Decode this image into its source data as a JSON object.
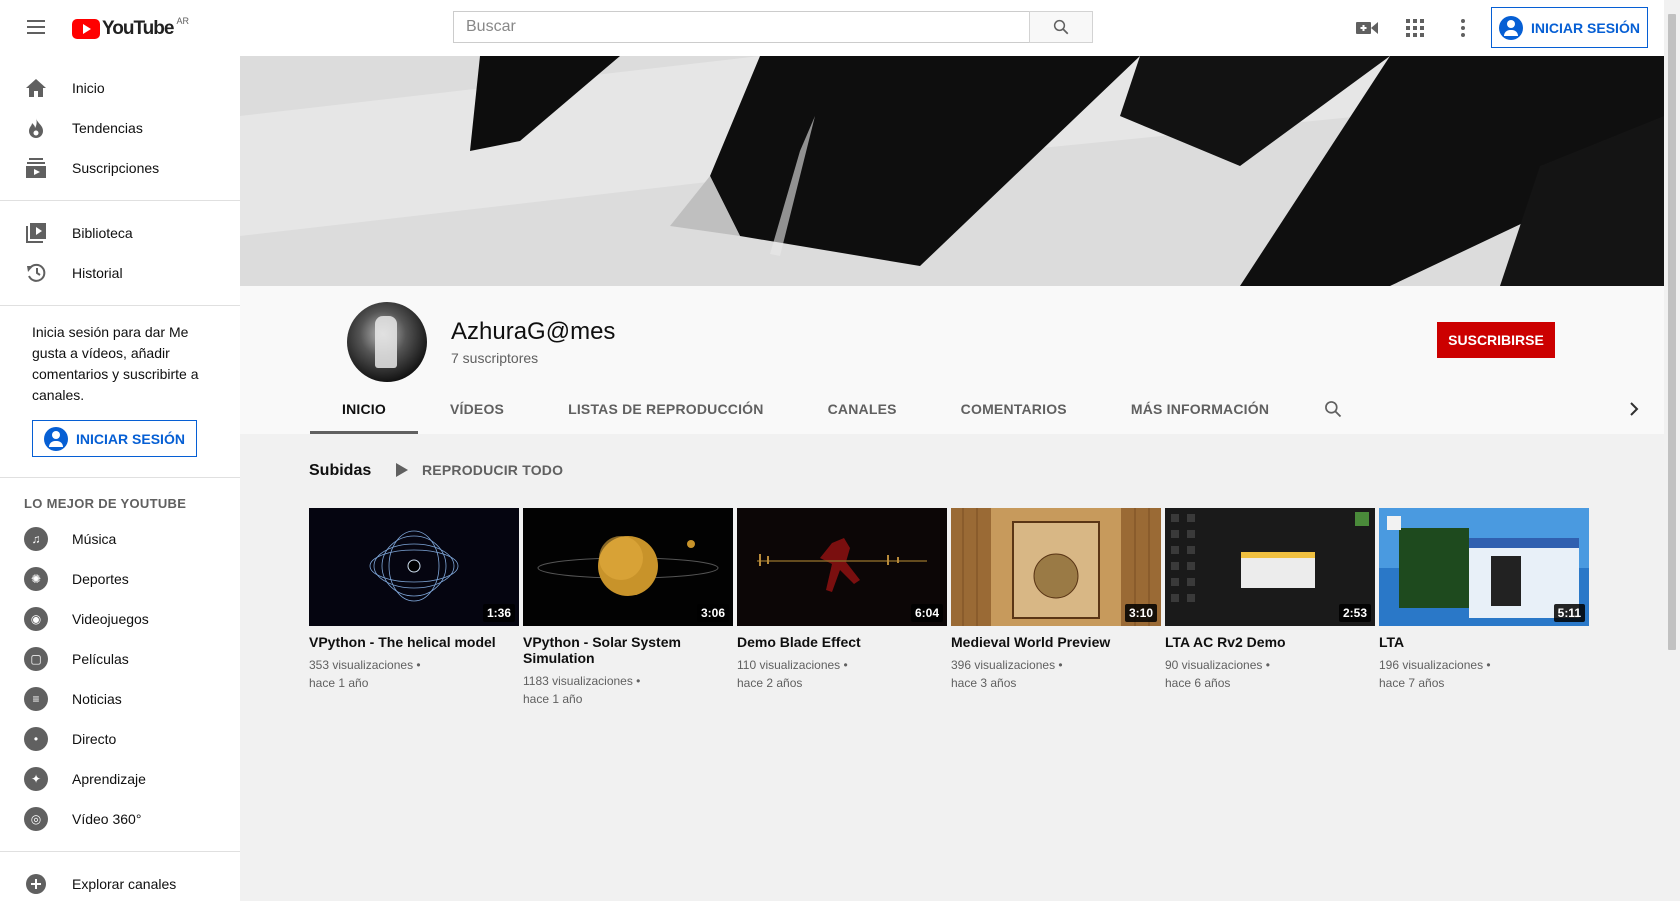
{
  "header": {
    "logo_text": "YouTube",
    "country": "AR",
    "search_placeholder": "Buscar",
    "signin_label": "INICIAR SESIÓN"
  },
  "sidebar": {
    "main": [
      {
        "label": "Inicio",
        "icon": "home-icon"
      },
      {
        "label": "Tendencias",
        "icon": "fire-icon"
      },
      {
        "label": "Suscripciones",
        "icon": "subscriptions-icon"
      }
    ],
    "library": [
      {
        "label": "Biblioteca",
        "icon": "library-icon"
      },
      {
        "label": "Historial",
        "icon": "history-icon"
      }
    ],
    "promo_text": "Inicia sesión para dar Me gusta a vídeos, añadir comentarios y suscribirte a canales.",
    "signin_label": "INICIAR SESIÓN",
    "best_heading": "LO MEJOR DE YOUTUBE",
    "categories": [
      {
        "label": "Música",
        "icon": "music-icon"
      },
      {
        "label": "Deportes",
        "icon": "sports-icon"
      },
      {
        "label": "Videojuegos",
        "icon": "gaming-icon"
      },
      {
        "label": "Películas",
        "icon": "movies-icon"
      },
      {
        "label": "Noticias",
        "icon": "news-icon"
      },
      {
        "label": "Directo",
        "icon": "live-icon"
      },
      {
        "label": "Aprendizaje",
        "icon": "learning-icon"
      },
      {
        "label": "Vídeo 360°",
        "icon": "vr-icon"
      }
    ],
    "explore_label": "Explorar canales"
  },
  "channel": {
    "name": "AzhuraG@mes",
    "subscribers": "7 suscriptores",
    "subscribe_label": "SUSCRIBIRSE",
    "tabs": [
      "INICIO",
      "VÍDEOS",
      "LISTAS DE REPRODUCCIÓN",
      "CANALES",
      "COMENTARIOS",
      "MÁS INFORMACIÓN"
    ]
  },
  "shelf": {
    "title": "Subidas",
    "play_all": "REPRODUCIR TODO",
    "videos": [
      {
        "title": "VPython - The helical model",
        "duration": "1:36",
        "views": "353 visualizaciones •",
        "age": "hace 1 año"
      },
      {
        "title": "VPython - Solar System Simulation",
        "duration": "3:06",
        "views": "1183 visualizaciones •",
        "age": "hace 1 año"
      },
      {
        "title": "Demo Blade Effect",
        "duration": "6:04",
        "views": "110 visualizaciones •",
        "age": "hace 2 años"
      },
      {
        "title": "Medieval World Preview",
        "duration": "3:10",
        "views": "396 visualizaciones •",
        "age": "hace 3 años"
      },
      {
        "title": "LTA AC Rv2 Demo",
        "duration": "2:53",
        "views": "90 visualizaciones •",
        "age": "hace 6 años"
      },
      {
        "title": "LTA",
        "duration": "5:11",
        "views": "196 visualizaciones •",
        "age": "hace 7 años"
      }
    ]
  }
}
